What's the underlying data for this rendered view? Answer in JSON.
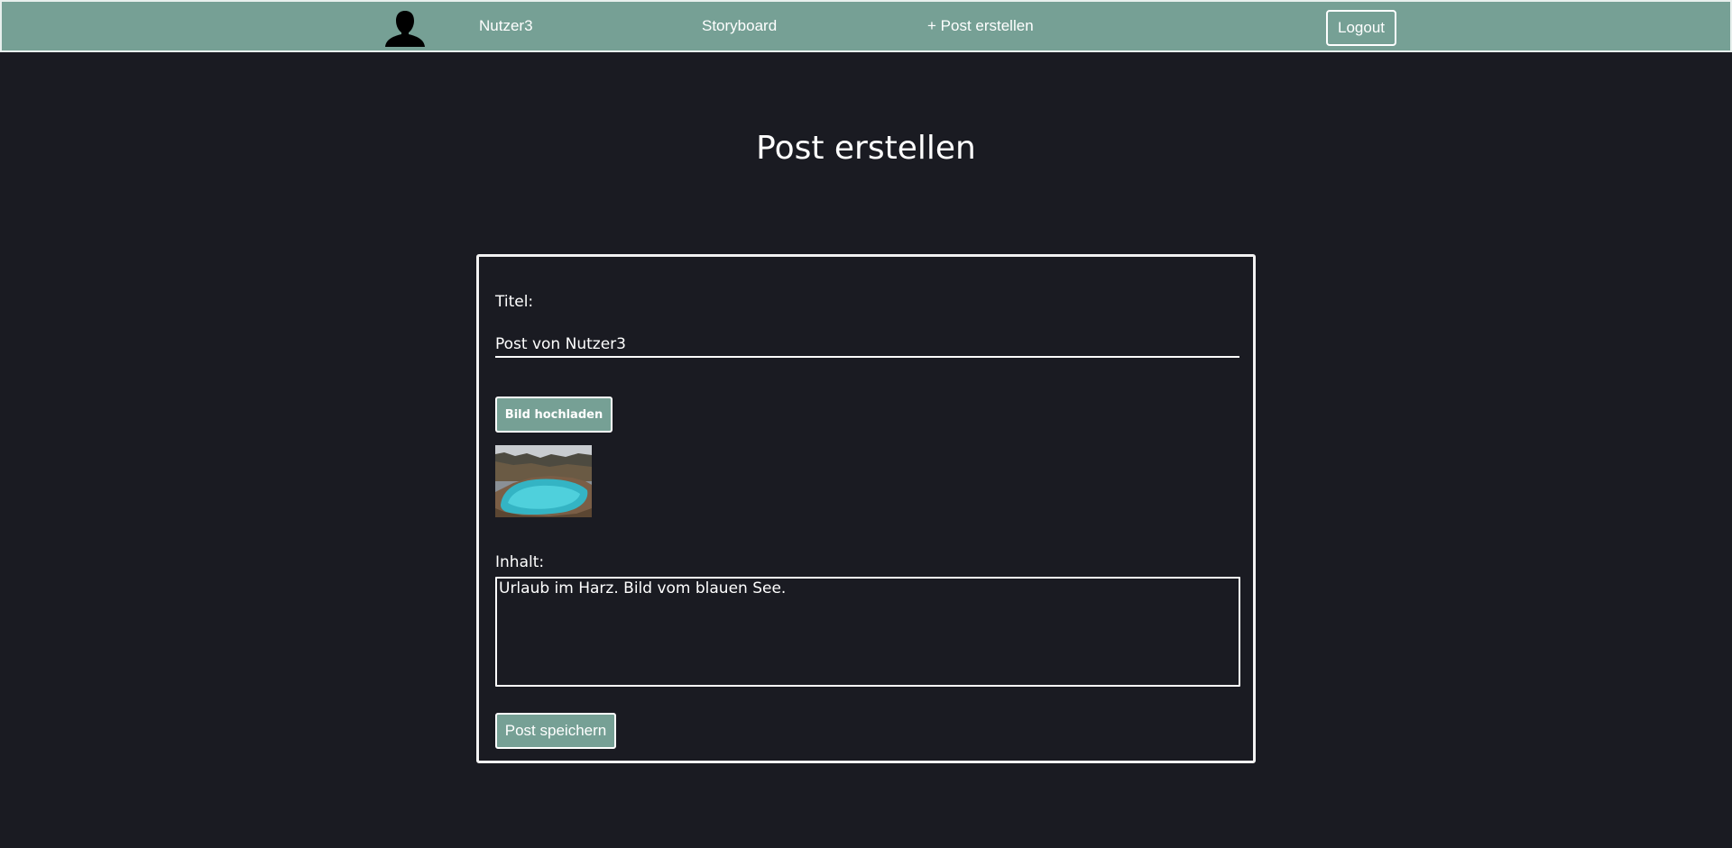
{
  "nav": {
    "avatar_icon": "user-silhouette-icon",
    "username": "Nutzer3",
    "storyboard": "Storyboard",
    "create_post": "+ Post erstellen",
    "logout": "Logout"
  },
  "page": {
    "title": "Post erstellen"
  },
  "form": {
    "title_label": "Titel:",
    "title_value": "Post von Nutzer3",
    "upload_label": "Bild hochladen",
    "content_label": "Inhalt:",
    "content_value": "Urlaub im Harz. Bild vom blauen See.",
    "save_label": "Post speichern"
  },
  "colors": {
    "accent": "#76a095",
    "background": "#1a1b22",
    "text": "#ffffff"
  }
}
